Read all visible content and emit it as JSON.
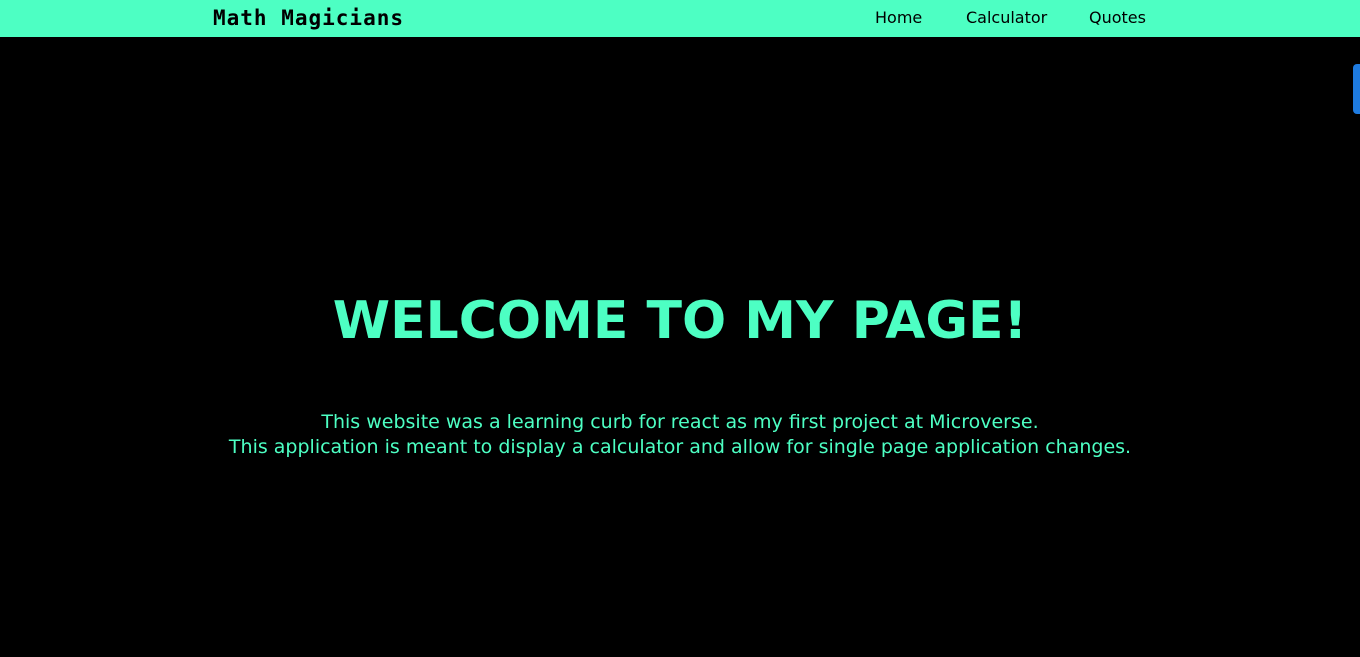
{
  "header": {
    "brand": "Math Magicians",
    "nav": [
      {
        "label": "Home"
      },
      {
        "label": "Calculator"
      },
      {
        "label": "Quotes"
      }
    ]
  },
  "main": {
    "title": "WELCOME TO MY PAGE!",
    "lines": [
      "This website was a learning curb for react as my first project at Microverse.",
      "This application is meant to display a calculator and allow for single page application changes."
    ]
  },
  "colors": {
    "accent": "#4dffc3",
    "background": "#000000",
    "side_tab": "#1e7be0"
  }
}
